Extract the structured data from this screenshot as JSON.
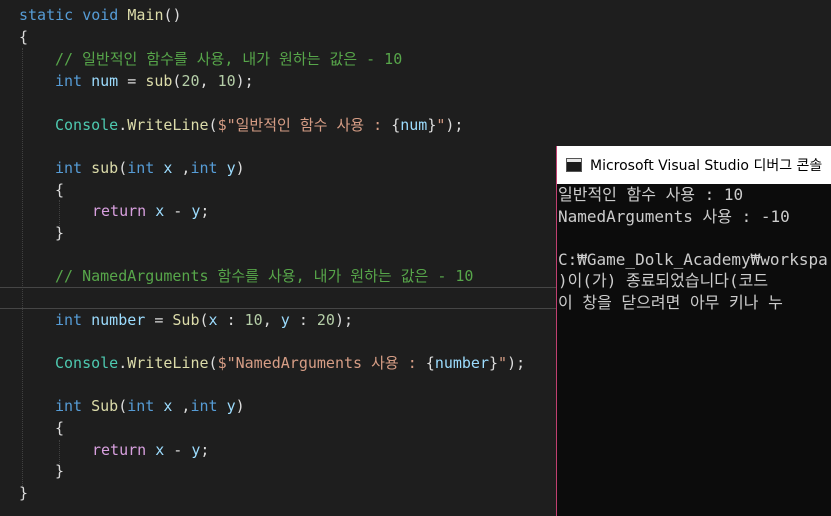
{
  "code": {
    "l0": {
      "static": "static",
      "void": "void",
      "main": "Main",
      "paren": "()"
    },
    "l1": {
      "brace": "{"
    },
    "l2": {
      "comment": "// 일반적인 함수를 사용, 내가 원하는 값은 - 10"
    },
    "l3": {
      "int": "int",
      "var": "num",
      "eq": " = ",
      "fn": "sub",
      "open": "(",
      "a": "20",
      "comma": ", ",
      "b": "10",
      "close": ");"
    },
    "l4": {
      "cls": "Console",
      "dot": ".",
      "fn": "WriteLine",
      "open": "(",
      "str1": "$\"일반적인 함수 사용 : ",
      "brace_open": "{",
      "var": "num",
      "brace_close": "}",
      "str2": "\"",
      "close": ");"
    },
    "l5": {
      "int": "int",
      "fn": "sub",
      "open": "(",
      "int2": "int",
      "x": "x",
      "sep": " ,",
      "int3": "int",
      "y": "y",
      "close": ")"
    },
    "l6": {
      "brace": "{"
    },
    "l7": {
      "ret": "return",
      "x": "x",
      "op": " - ",
      "y": "y",
      "semi": ";"
    },
    "l8": {
      "brace": "}"
    },
    "l9": {
      "comment": "// NamedArguments 함수를 사용, 내가 원하는 값은 - 10"
    },
    "l10": {
      "int": "int",
      "var": "number",
      "eq": " = ",
      "fn": "Sub",
      "open": "(",
      "x": "x",
      "c1": " : ",
      "a": "10",
      "comma": ", ",
      "y": "y",
      "c2": " : ",
      "b": "20",
      "close": ");"
    },
    "l11": {
      "cls": "Console",
      "dot": ".",
      "fn": "WriteLine",
      "open": "(",
      "str1": "$\"NamedArguments 사용 : ",
      "brace_open": "{",
      "var": "number",
      "brace_close": "}",
      "str2": "\"",
      "close": ");"
    },
    "l12": {
      "int": "int",
      "fn": "Sub",
      "open": "(",
      "int2": "int",
      "x": "x",
      "sep": " ,",
      "int3": "int",
      "y": "y",
      "close": ")"
    },
    "l13": {
      "brace": "{"
    },
    "l14": {
      "ret": "return",
      "x": "x",
      "op": " - ",
      "y": "y",
      "semi": ";"
    },
    "l15": {
      "brace": "}"
    },
    "l16": {
      "brace": "}"
    }
  },
  "console": {
    "title": "Microsoft Visual Studio 디버그 콘솔",
    "lines": [
      "일반적인 함수 사용 : 10",
      "NamedArguments 사용 : -10",
      "",
      "C:₩Game_Dolk_Academy₩workspa",
      ")이(가) 종료되었습니다(코드",
      "이 창을 닫으려면 아무 키나 누"
    ]
  }
}
